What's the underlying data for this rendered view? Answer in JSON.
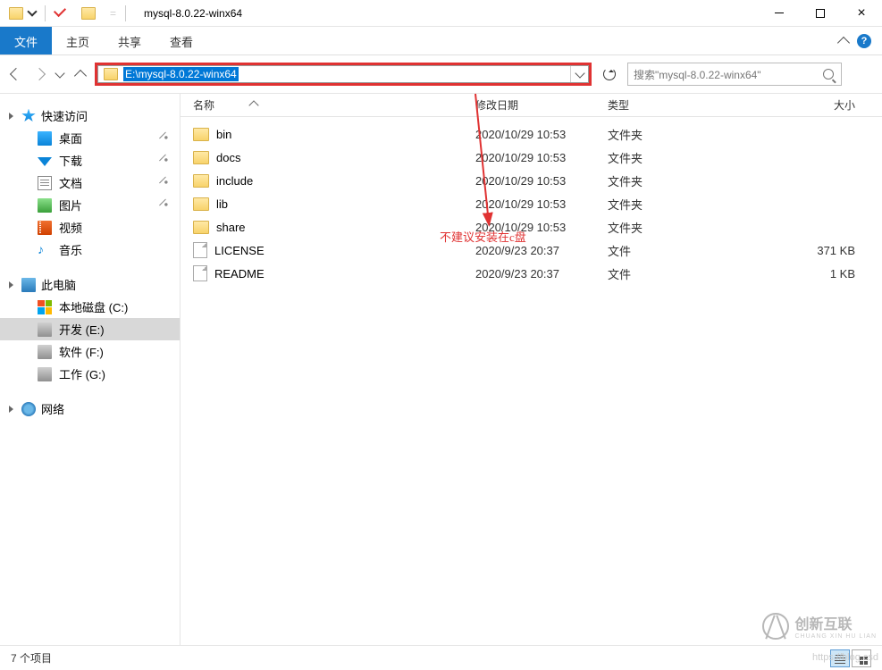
{
  "title": "mysql-8.0.22-winx64",
  "tabs": {
    "file": "文件",
    "home": "主页",
    "share": "共享",
    "view": "查看"
  },
  "address": "E:\\mysql-8.0.22-winx64",
  "search_placeholder": "搜索\"mysql-8.0.22-winx64\"",
  "columns": {
    "name": "名称",
    "date": "修改日期",
    "type": "类型",
    "size": "大小"
  },
  "sidebar": {
    "quick": "快速访问",
    "quick_items": [
      {
        "label": "桌面",
        "icon": "desktop",
        "pin": true
      },
      {
        "label": "下载",
        "icon": "dl",
        "pin": true
      },
      {
        "label": "文档",
        "icon": "doc",
        "pin": true
      },
      {
        "label": "图片",
        "icon": "pic",
        "pin": true
      },
      {
        "label": "视频",
        "icon": "vid",
        "pin": false
      },
      {
        "label": "音乐",
        "icon": "mus",
        "pin": false
      }
    ],
    "pc": "此电脑",
    "pc_items": [
      {
        "label": "本地磁盘 (C:)",
        "icon": "oswin",
        "sel": false
      },
      {
        "label": "开发 (E:)",
        "icon": "disk",
        "sel": true
      },
      {
        "label": "软件 (F:)",
        "icon": "disk",
        "sel": false
      },
      {
        "label": "工作 (G:)",
        "icon": "disk",
        "sel": false
      }
    ],
    "network": "网络"
  },
  "files": [
    {
      "name": "bin",
      "date": "2020/10/29 10:53",
      "type": "文件夹",
      "size": "",
      "folder": true
    },
    {
      "name": "docs",
      "date": "2020/10/29 10:53",
      "type": "文件夹",
      "size": "",
      "folder": true
    },
    {
      "name": "include",
      "date": "2020/10/29 10:53",
      "type": "文件夹",
      "size": "",
      "folder": true
    },
    {
      "name": "lib",
      "date": "2020/10/29 10:53",
      "type": "文件夹",
      "size": "",
      "folder": true
    },
    {
      "name": "share",
      "date": "2020/10/29 10:53",
      "type": "文件夹",
      "size": "",
      "folder": true
    },
    {
      "name": "LICENSE",
      "date": "2020/9/23 20:37",
      "type": "文件",
      "size": "371 KB",
      "folder": false
    },
    {
      "name": "README",
      "date": "2020/9/23 20:37",
      "type": "文件",
      "size": "1 KB",
      "folder": false
    }
  ],
  "annotation": "不建议安装在c盘",
  "status": "7 个项目",
  "watermark": {
    "text": "创新互联",
    "sub": "CHUANG XIN HU LIAN",
    "url": "https://blog.csd"
  }
}
